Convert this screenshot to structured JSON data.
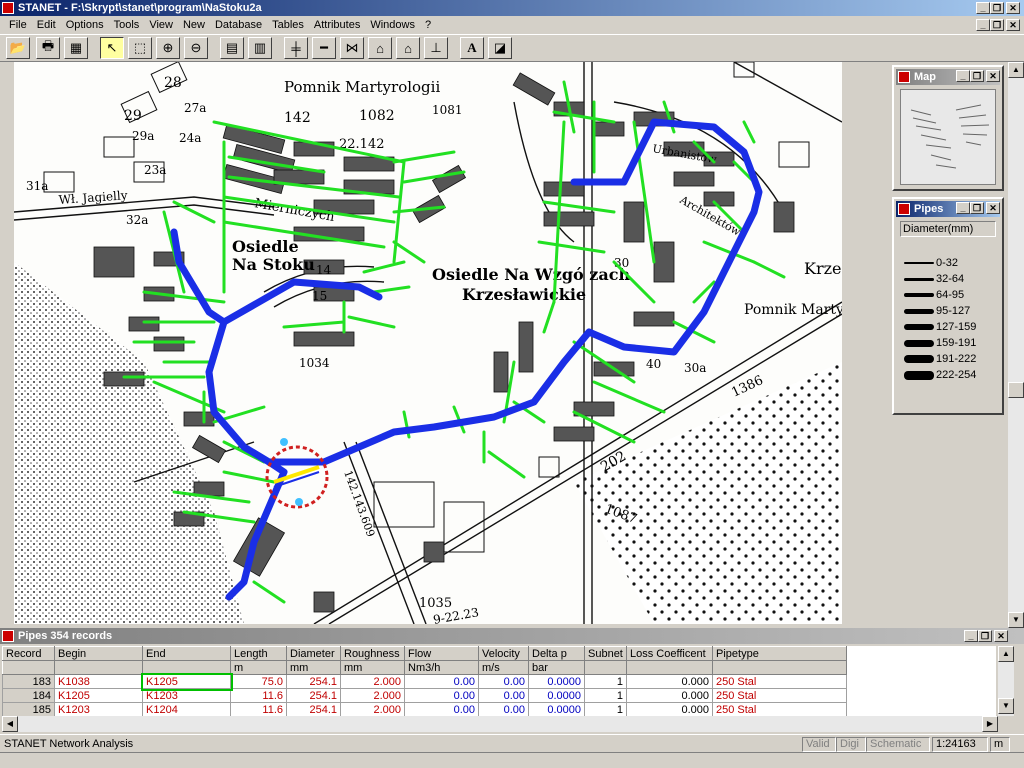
{
  "window": {
    "title": "STANET - F:\\Skrypt\\stanet\\program\\NaStoku2a",
    "min": "_",
    "restore": "❐",
    "close": "✕"
  },
  "menu": [
    "File",
    "Edit",
    "Options",
    "Tools",
    "View",
    "New",
    "Database",
    "Tables",
    "Attributes",
    "Windows",
    "?"
  ],
  "toolbar": {
    "icons": [
      "open-icon",
      "print-icon",
      "calculator-icon",
      "pointer-icon",
      "select-region-icon",
      "zoom-in-icon",
      "zoom-out-icon",
      "table-icon",
      "form-icon",
      "pipe-icon",
      "line-icon",
      "valve-icon",
      "station-icon",
      "house-icon",
      "meter-icon",
      "text-icon",
      "fill-icon"
    ],
    "glyphs": [
      "📂",
      "🖶",
      "▦",
      "↖",
      "⬚",
      "⊕",
      "⊖",
      "▤",
      "▥",
      "╪",
      "━",
      "⋈",
      "⌂",
      "⌂",
      "⊥",
      "A",
      "◪"
    ]
  },
  "map": {
    "labels": {
      "pomnik": "Pomnik Martyrologii",
      "n142": "142",
      "n1082": "1082",
      "n1081": "1081",
      "n22142": "22.142",
      "osiedle1a": "Osiedle",
      "osiedle1b": "Na Stoku",
      "osiedle2a": "Osiedle Na Wzgó zach",
      "osiedle2b": "Krzesławickie",
      "mierniczych": "Mierniczych",
      "jagielly": "Wł. Jagielly",
      "urbanistow": "Urbanistów",
      "architektow": "Architektów",
      "pomnik2": "Pomnik Marty",
      "krze": "Krze",
      "n202": "202",
      "n1386": "1386",
      "n1087": "1087",
      "n1035": "1035",
      "n1034": "1034",
      "road": "9-22.23",
      "road2": "142.143.609",
      "n14": "14",
      "n15": "15",
      "n30": "30",
      "n40": "40",
      "n28": "28",
      "n29": "29",
      "n30a": "30a",
      "n23a": "23a",
      "n32a": "32a",
      "n24a": "24a",
      "n29a": "29a",
      "n27a": "27a",
      "n31a": "31a"
    },
    "colors": {
      "pipe_main": "#1a2ee6",
      "pipe_branch": "#22e022",
      "selection": "#d02020"
    }
  },
  "mini_map": {
    "title": "Map"
  },
  "legend": {
    "title": "Pipes",
    "field": "Diameter(mm)",
    "items": [
      {
        "label": "0-32",
        "w": 1
      },
      {
        "label": "32-64",
        "w": 2
      },
      {
        "label": "64-95",
        "w": 3
      },
      {
        "label": "95-127",
        "w": 4
      },
      {
        "label": "127-159",
        "w": 5
      },
      {
        "label": "159-191",
        "w": 6
      },
      {
        "label": "191-222",
        "w": 7
      },
      {
        "label": "222-254",
        "w": 8
      }
    ]
  },
  "table": {
    "title": "Pipes 354 records",
    "columns": [
      "Record",
      "Begin",
      "End",
      "Length",
      "Diameter",
      "Roughness",
      "Flow",
      "Velocity",
      "Delta p",
      "Subnet",
      "Loss Coefficent",
      "Pipetype"
    ],
    "units": [
      "",
      "",
      "",
      "m",
      "mm",
      "mm",
      "Nm3/h",
      "m/s",
      "bar",
      "",
      "",
      ""
    ],
    "rows": [
      [
        "183",
        "K1038",
        "K1205",
        "75.0",
        "254.1",
        "2.000",
        "0.00",
        "0.00",
        "0.0000",
        "1",
        "0.000",
        "250 Stal"
      ],
      [
        "184",
        "K1205",
        "K1203",
        "11.6",
        "254.1",
        "2.000",
        "0.00",
        "0.00",
        "0.0000",
        "1",
        "0.000",
        "250 Stal"
      ],
      [
        "185",
        "K1203",
        "K1204",
        "11.6",
        "254.1",
        "2.000",
        "0.00",
        "0.00",
        "0.0000",
        "1",
        "0.000",
        "250 Stal"
      ]
    ]
  },
  "status": {
    "text": "STANET Network Analysis",
    "valid": "Valid",
    "digi": "Digi",
    "schematic": "Schematic",
    "scale": "1:24163",
    "unit": "m"
  }
}
